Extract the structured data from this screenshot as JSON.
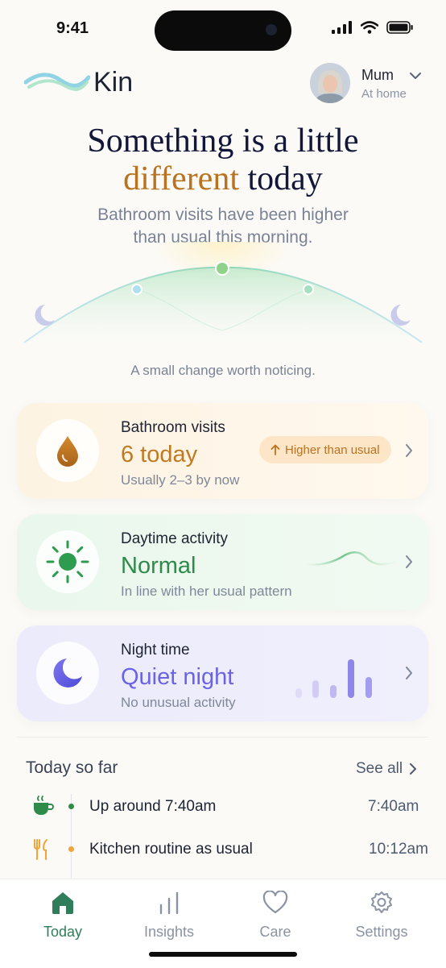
{
  "status_bar": {
    "time": "9:41"
  },
  "header": {
    "app_name": "Kin",
    "profile": {
      "name": "Mum",
      "status": "At home"
    }
  },
  "hero": {
    "headline_line1": "Something is a little",
    "headline_accent": "different",
    "headline_rest": " today",
    "subline_line1": "Bathroom visits have been higher",
    "subline_line2": "than usual this morning.",
    "note": "A small change worth noticing."
  },
  "cards": {
    "bathroom": {
      "title": "Bathroom visits",
      "value": "6 today",
      "sub": "Usually 2–3 by now",
      "badge": "Higher than usual",
      "icon": "droplet-icon",
      "color": "#b9721f"
    },
    "daytime": {
      "title": "Daytime activity",
      "value": "Normal",
      "sub": "In line with her usual pattern",
      "icon": "sun-icon",
      "color": "#2e8b49"
    },
    "night": {
      "title": "Night time",
      "value": "Quiet night",
      "sub": "No unusual activity",
      "icon": "moon-icon",
      "color": "#6a63e6"
    }
  },
  "today": {
    "title": "Today so far",
    "see_all": "See all",
    "events": [
      {
        "text": "Up around 7:40am",
        "time": "7:40am",
        "icon": "cup-icon",
        "dot_color": "#2e8b49"
      },
      {
        "text": "Kitchen routine as usual",
        "time": "10:12am",
        "icon": "cutlery-icon",
        "dot_color": "#f0a43a"
      }
    ]
  },
  "tabs": [
    {
      "label": "Today",
      "icon": "home-icon",
      "active": true
    },
    {
      "label": "Insights",
      "icon": "bar-chart-icon",
      "active": false
    },
    {
      "label": "Care",
      "icon": "heart-icon",
      "active": false
    },
    {
      "label": "Settings",
      "icon": "gear-icon",
      "active": false
    }
  ]
}
